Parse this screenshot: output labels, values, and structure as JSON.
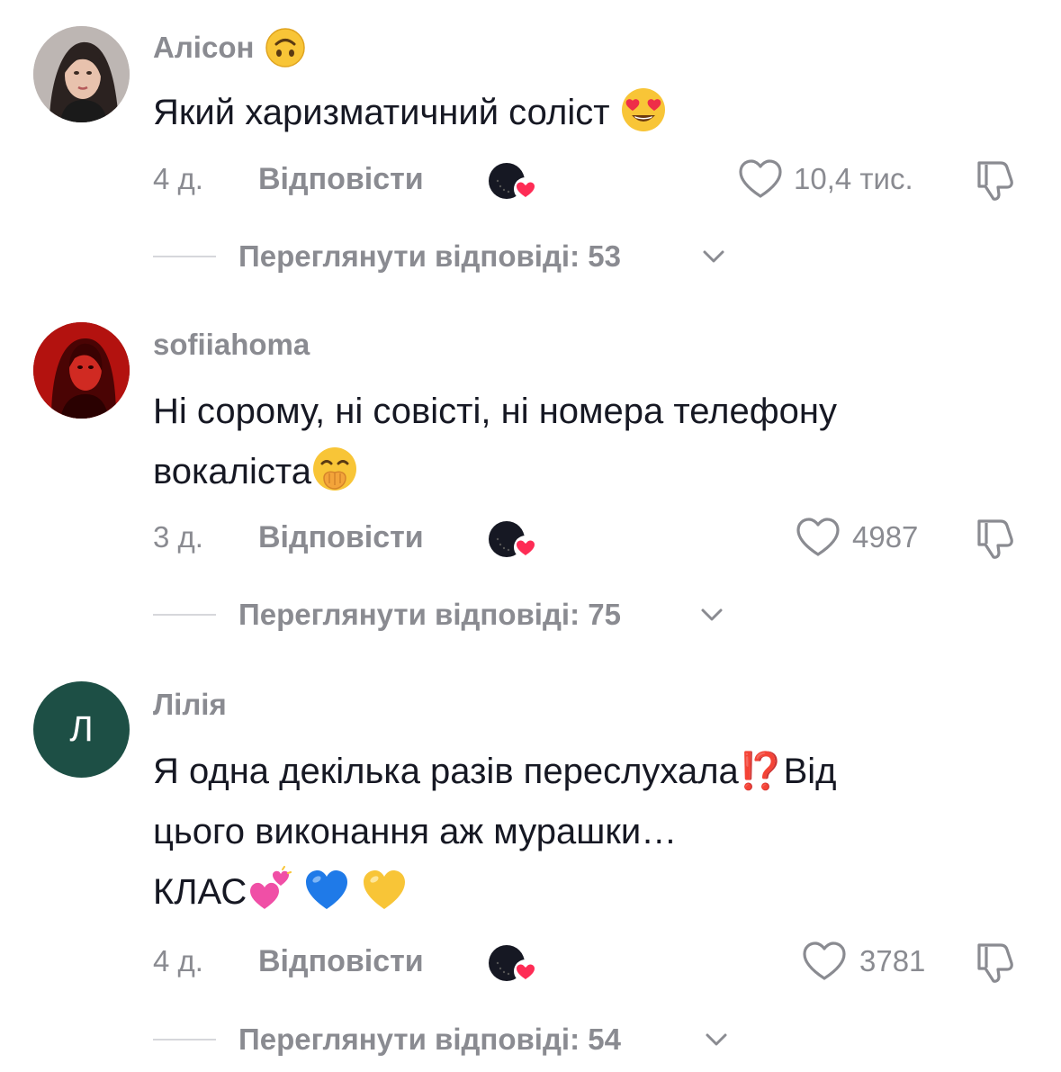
{
  "comments": [
    {
      "username": "Алісон",
      "username_emoji": "upside-down-face-icon",
      "text": "Який харизматичний соліст",
      "text_emoji": "heart-eyes-face-icon",
      "time": "4 д.",
      "reply_label": "Відповісти",
      "likes": "10,4 тис.",
      "replies_label": "Переглянути відповіді: 53",
      "avatar": "photo"
    },
    {
      "username": "sofiiahoma",
      "text_line1": "Ні сорому, ні совісті, ні номера телефону",
      "text_line2": "вокаліста",
      "text_emoji": "hand-over-mouth-face-icon",
      "time": "3 д.",
      "reply_label": "Відповісти",
      "likes": "4987",
      "replies_label": "Переглянути відповіді: 75",
      "avatar": "photo-red"
    },
    {
      "username": "Лілія",
      "avatar_letter": "Л",
      "text_line1": "Я одна декілька разів переслухала⁉️Від",
      "text_line2": "цього виконання аж мурашки…",
      "text_line3": "КЛАС",
      "text_emojis": [
        "two-hearts-icon",
        "blue-heart-icon",
        "yellow-heart-icon"
      ],
      "time": "4 д.",
      "reply_label": "Відповісти",
      "likes": "3781",
      "replies_label": "Переглянути відповіді: 54",
      "avatar_color": "#1d4f45"
    }
  ],
  "colors": {
    "secondary_text": "#8a8b91",
    "primary_text": "#161823",
    "creator_heart": "#fe2c55"
  }
}
